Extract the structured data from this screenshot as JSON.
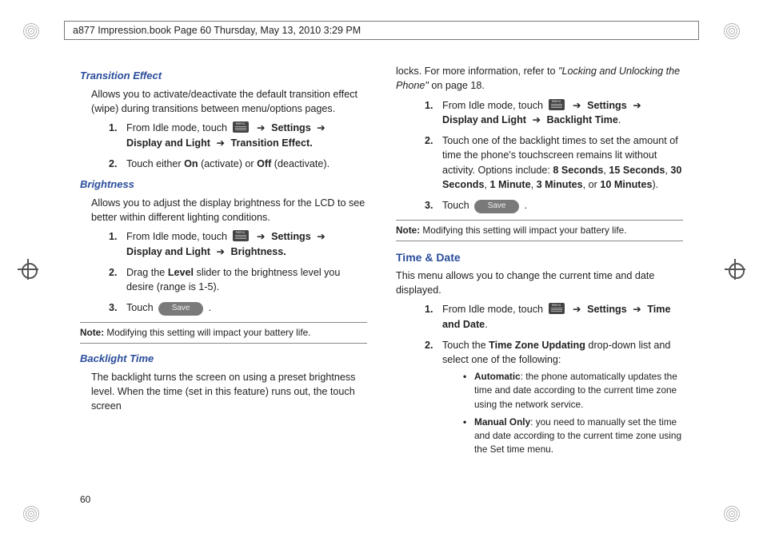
{
  "header": "a877 Impression.book  Page 60  Thursday, May 13, 2010  3:29 PM",
  "page_number": "60",
  "arrow": "➔",
  "menu_icon_name": "menu-icon",
  "left": {
    "transition": {
      "title": "Transition Effect",
      "intro": "Allows you to activate/deactivate the default transition effect (wipe) during transitions between menu/options pages.",
      "step1_a": "From Idle mode, touch ",
      "step1_b": " Settings ",
      "step1_c": " Display and Light ",
      "step1_d": " Transition Effect.",
      "step2_a": "Touch either ",
      "step2_on": "On",
      "step2_mid": " (activate) or ",
      "step2_off": "Off",
      "step2_end": " (deactivate)."
    },
    "brightness": {
      "title": "Brightness",
      "intro": "Allows you to adjust the display brightness for the LCD to see better within different lighting conditions.",
      "step1_a": "From Idle mode, touch ",
      "step1_b": " Settings ",
      "step1_c": " Display and Light ",
      "step1_d": " Brightness.",
      "step2_a": "Drag the ",
      "step2_level": "Level",
      "step2_b": " slider to the brightness level you desire (range is 1-5).",
      "step3_a": "Touch ",
      "step3_save": "Save",
      "step3_b": ".",
      "note_label": "Note:",
      "note_text": " Modifying this setting will impact your battery life."
    },
    "backlight": {
      "title": "Backlight Time",
      "intro": "The backlight turns the screen on using a preset brightness level. When the time (set in this feature) runs out, the touch screen"
    }
  },
  "right": {
    "cont_a": "locks. For more information, refer to ",
    "cont_ref": "\"Locking and Unlocking the Phone\"",
    "cont_b": "  on page 18.",
    "bl_step1_a": "From Idle mode, touch ",
    "bl_step1_b": " Settings ",
    "bl_step1_c": " Display and Light ",
    "bl_step1_d": " Backlight Time",
    "bl_step1_e": ".",
    "bl_step2_a": "Touch one of the backlight times to set the amount of time the phone's touchscreen remains lit without activity. Options include: ",
    "bl_opts": [
      "8 Seconds",
      "15 Seconds",
      "30 Seconds",
      "1 Minute",
      "3 Minutes",
      "10 Minutes"
    ],
    "bl_step2_sep": ", ",
    "bl_step2_or": ", or ",
    "bl_step2_end": ").",
    "bl_step3_a": "Touch ",
    "bl_step3_save": "Save",
    "bl_step3_b": ".",
    "note_label": "Note:",
    "note_text": " Modifying this setting will impact your battery life.",
    "timedate": {
      "title": "Time & Date",
      "intro": "This menu allows you to change the current time and date displayed.",
      "step1_a": "From Idle mode, touch ",
      "step1_b": " Settings ",
      "step1_c": " Time and Date",
      "step1_d": ".",
      "step2_a": "Touch the ",
      "step2_tz": "Time Zone Updating",
      "step2_b": " drop-down list and select one of the following:",
      "bullet1_head": "Automatic",
      "bullet1_body": ": the phone automatically updates the time and date according to the current time zone using the network service.",
      "bullet2_head": "Manual Only",
      "bullet2_body": ": you need to manually set the time and date according to the current time zone using the Set time menu."
    }
  }
}
